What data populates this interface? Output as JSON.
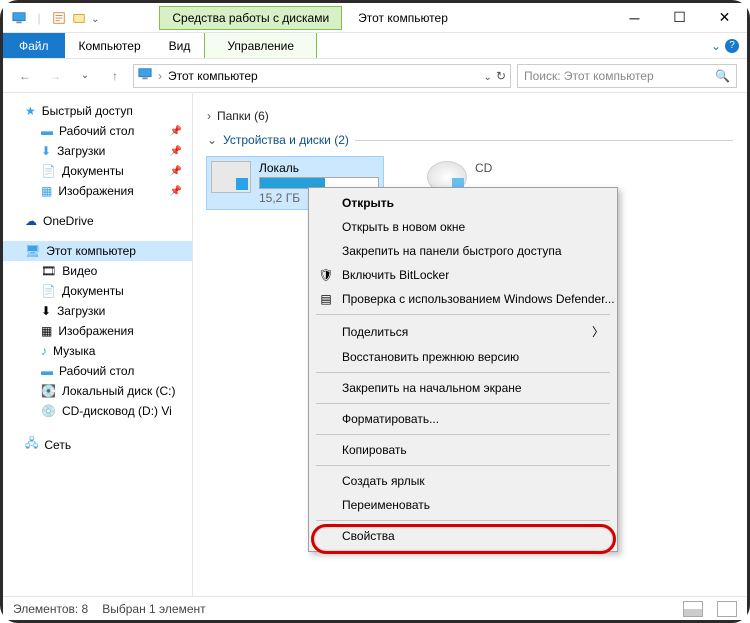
{
  "titlebar": {
    "context_tab": "Средства работы с дисками",
    "title": "Этот компьютер"
  },
  "ribbon": {
    "file": "Файл",
    "tabs": [
      "Компьютер",
      "Вид"
    ],
    "context": "Управление"
  },
  "navbar": {
    "address": "Этот компьютер",
    "search_placeholder": "Поиск: Этот компьютер"
  },
  "sidebar": {
    "quick_access": "Быстрый доступ",
    "quick_items": [
      {
        "label": "Рабочий стол",
        "pin": true
      },
      {
        "label": "Загрузки",
        "pin": true
      },
      {
        "label": "Документы",
        "pin": true
      },
      {
        "label": "Изображения",
        "pin": true
      }
    ],
    "onedrive": "OneDrive",
    "this_pc": "Этот компьютер",
    "pc_items": [
      "Видео",
      "Документы",
      "Загрузки",
      "Изображения",
      "Музыка",
      "Рабочий стол",
      "Локальный диск (C:)",
      "CD-дисковод (D:) Vi"
    ],
    "network": "Сеть"
  },
  "content": {
    "folders_hdr": "Папки (6)",
    "devices_hdr": "Устройства и диски (2)",
    "drive1": {
      "name": "Локаль",
      "sub": "15,2 ГБ"
    },
    "drive2_partial": "CD"
  },
  "context_menu": {
    "items": [
      {
        "label": "Открыть",
        "bold": true
      },
      {
        "label": "Открыть в новом окне"
      },
      {
        "label": "Закрепить на панели быстрого доступа"
      },
      {
        "label": "Включить BitLocker",
        "icon": "shield"
      },
      {
        "label": "Проверка с использованием Windows Defender...",
        "icon": "defender"
      },
      {
        "sep": true
      },
      {
        "label": "Поделиться",
        "submenu": true
      },
      {
        "label": "Восстановить прежнюю версию"
      },
      {
        "sep": true
      },
      {
        "label": "Закрепить на начальном экране"
      },
      {
        "sep": true
      },
      {
        "label": "Форматировать..."
      },
      {
        "sep": true
      },
      {
        "label": "Копировать"
      },
      {
        "sep": true
      },
      {
        "label": "Создать ярлык"
      },
      {
        "label": "Переименовать"
      },
      {
        "sep": true
      },
      {
        "label": "Свойства",
        "highlight": true
      }
    ]
  },
  "statusbar": {
    "count": "Элементов: 8",
    "selected": "Выбран 1 элемент"
  }
}
